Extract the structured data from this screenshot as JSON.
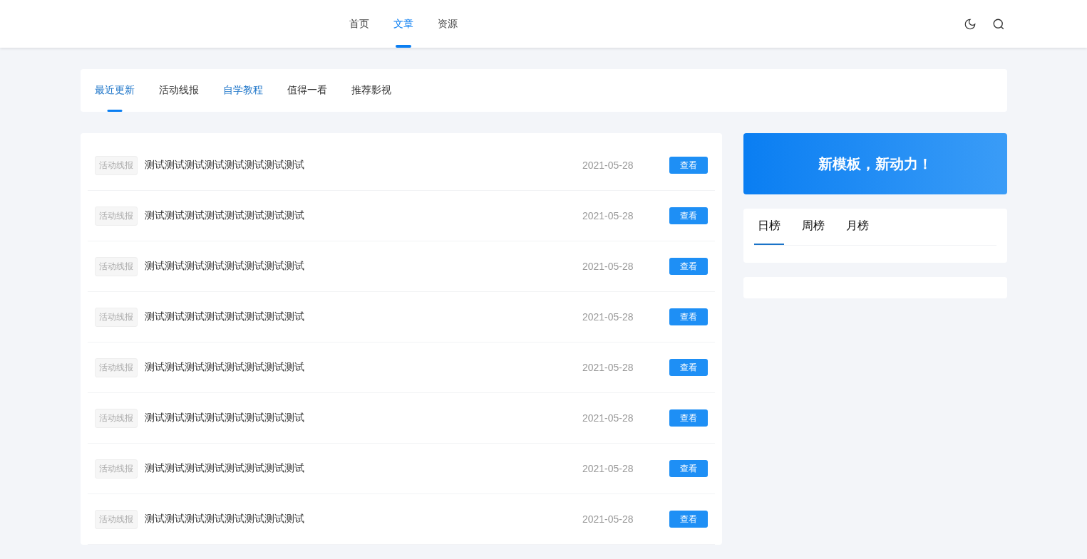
{
  "nav": {
    "items": [
      {
        "label": "首页",
        "selected": false
      },
      {
        "label": "文章",
        "selected": true
      },
      {
        "label": "资源",
        "selected": false
      }
    ]
  },
  "categories": [
    {
      "label": "最近更新",
      "selected": true,
      "highlighted": true
    },
    {
      "label": "活动线报",
      "selected": false,
      "highlighted": false
    },
    {
      "label": "自学教程",
      "selected": false,
      "highlighted": true
    },
    {
      "label": "值得一看",
      "selected": false,
      "highlighted": false
    },
    {
      "label": "推荐影视",
      "selected": false,
      "highlighted": false
    }
  ],
  "articles": [
    {
      "tag": "活动线报",
      "title": "测试测试测试测试测试测试测试测试",
      "date": "2021-05-28",
      "action": "查看"
    },
    {
      "tag": "活动线报",
      "title": "测试测试测试测试测试测试测试测试",
      "date": "2021-05-28",
      "action": "查看"
    },
    {
      "tag": "活动线报",
      "title": "测试测试测试测试测试测试测试测试",
      "date": "2021-05-28",
      "action": "查看"
    },
    {
      "tag": "活动线报",
      "title": "测试测试测试测试测试测试测试测试",
      "date": "2021-05-28",
      "action": "查看"
    },
    {
      "tag": "活动线报",
      "title": "测试测试测试测试测试测试测试测试",
      "date": "2021-05-28",
      "action": "查看"
    },
    {
      "tag": "活动线报",
      "title": "测试测试测试测试测试测试测试测试",
      "date": "2021-05-28",
      "action": "查看"
    },
    {
      "tag": "活动线报",
      "title": "测试测试测试测试测试测试测试测试",
      "date": "2021-05-28",
      "action": "查看"
    },
    {
      "tag": "活动线报",
      "title": "测试测试测试测试测试测试测试测试",
      "date": "2021-05-28",
      "action": "查看"
    }
  ],
  "banner": {
    "text": "新模板，新动力！"
  },
  "ranking": {
    "tabs": [
      {
        "label": "日榜",
        "selected": true
      },
      {
        "label": "周榜",
        "selected": false
      },
      {
        "label": "月榜",
        "selected": false
      }
    ]
  }
}
